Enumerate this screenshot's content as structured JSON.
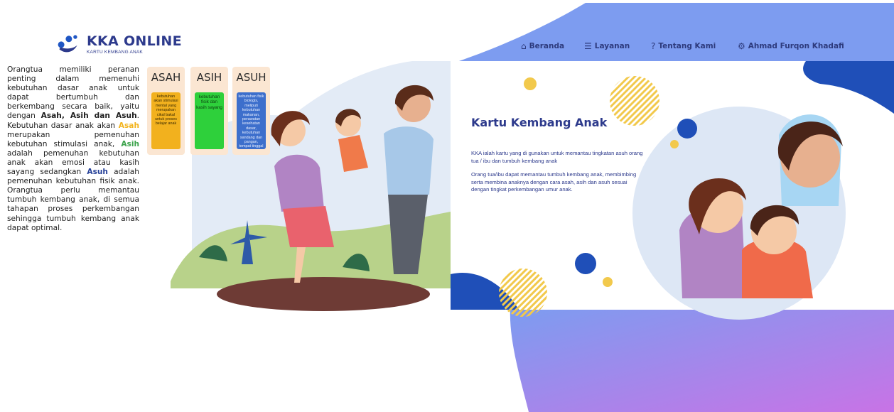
{
  "brand": {
    "name": "KKA ONLINE",
    "tagline": "KARTU KEMBANG ANAK",
    "colors": {
      "primary": "#2d3a8c",
      "dot": "#1f56c4"
    }
  },
  "intro": {
    "p1": "Orangtua memiliki peranan penting dalam memenuhi kebutuhan dasar anak untuk dapat bertumbuh dan berkembang secara baik, yaitu dengan ",
    "k1": "Asah, Asih dan Asuh",
    "p2": ". Kebutuhan dasar anak akan ",
    "asah": "Asah",
    "p3": " merupakan pemenuhan kebutuhan stimulasi anak, ",
    "asih": "Asih",
    "p4": " adalah pemenuhan kebutuhan anak akan emosi atau kasih sayang sedangkan ",
    "asuh": "Asuh",
    "p5": " adalah pemenuhan kebutuhan fisik anak. Orangtua perlu memantau tumbuh kembang anak, di semua tahapan proses perkembangan sehingga tumbuh kembang anak dapat optimal."
  },
  "cards": [
    {
      "title": "ASAH",
      "text": "kebutuhan akan stimulasi mental yang merupakan cikal bakal untuk proses belajar anak",
      "color": "#f2b11e"
    },
    {
      "title": "ASIH",
      "text": "kebutuhan fisik dan kasih sayang",
      "color": "#2ed03b"
    },
    {
      "title": "ASUH",
      "text": "kebutuhan fisik biologis, meliputi kebutuhan makanan, perawatan kesehatan dasar, kebutuhan sandang dan pangan, tempat tinggal yang layak, sanitasi dan kebersihan",
      "color": "#3d6fcc"
    }
  ],
  "nav": {
    "items": [
      {
        "label": "Beranda",
        "icon": "home-icon"
      },
      {
        "label": "Layanan",
        "icon": "document-icon"
      },
      {
        "label": "Tentang Kami",
        "icon": "question-icon"
      },
      {
        "label": "Ahmad Furqon Khadafi",
        "icon": "gear-icon"
      }
    ]
  },
  "hero": {
    "title": "Kartu Kembang Anak",
    "desc1": "KKA ialah kartu yang di gunakan untuk memantau tingkatan asuh orang tua / ibu dan tumbuh kembang anak",
    "desc2": "Orang tua/ibu dapat memantau tumbuh kembang anak, membimbing serta membina anaknya dengan cara asah, asih dan asuh sesuai dengan tingkat perkembangan umur anak."
  },
  "colors": {
    "gradient_start": "#7d9cf0",
    "gradient_end": "#c873e6",
    "navy_blob": "#1f4fb8",
    "accent_yellow": "#f2c94c",
    "hero_bg": "#dde7f5"
  }
}
